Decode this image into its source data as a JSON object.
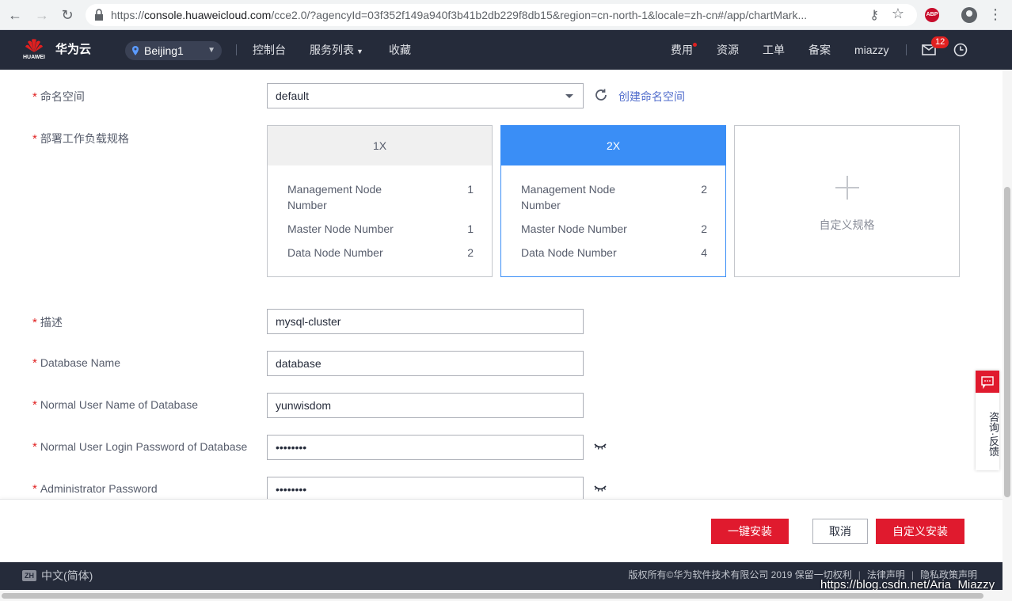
{
  "browser": {
    "url_prefix": "https://",
    "url_host": "console.huaweicloud.com",
    "url_rest": "/cce2.0/?agencyId=03f352f149a940f3b41b2db229f8db15&region=cn-north-1&locale=zh-cn#/app/chartMark...",
    "abp_label": "ABP"
  },
  "topnav": {
    "logo_text": "HUAWEI",
    "brand": "华为云",
    "region": "Beijing1",
    "console": "控制台",
    "services": "服务列表",
    "favorites": "收藏",
    "billing": "费用",
    "resources": "资源",
    "tickets": "工单",
    "filing": "备案",
    "user": "miazzy",
    "mail_count": "12"
  },
  "form": {
    "namespace": {
      "label": "命名空间",
      "value": "default",
      "create_link": "创建命名空间"
    },
    "workload_spec": {
      "label": "部署工作负载规格",
      "cards": [
        {
          "title": "1X",
          "rows": [
            {
              "name": "Management Node Number",
              "value": "1"
            },
            {
              "name": "Master Node Number",
              "value": "1"
            },
            {
              "name": "Data Node Number",
              "value": "2"
            }
          ]
        },
        {
          "title": "2X",
          "rows": [
            {
              "name": "Management Node Number",
              "value": "2"
            },
            {
              "name": "Master Node Number",
              "value": "2"
            },
            {
              "name": "Data Node Number",
              "value": "4"
            }
          ]
        }
      ],
      "custom_label": "自定义规格"
    },
    "description": {
      "label": "描述",
      "value": "mysql-cluster"
    },
    "db_name": {
      "label": "Database Name",
      "value": "database"
    },
    "db_user": {
      "label": "Normal User Name of Database",
      "value": "yunwisdom"
    },
    "db_password": {
      "label": "Normal User Login Password of Database",
      "value": "••••••••"
    },
    "admin_password": {
      "label": "Administrator Password",
      "value": "••••••••"
    }
  },
  "actions": {
    "quick_install": "一键安装",
    "cancel": "取消",
    "custom_install": "自定义安装"
  },
  "footer": {
    "lang_badge": "ZH",
    "language": "中文(简体)",
    "copyright": "版权所有©华为软件技术有限公司 2019 保留一切权利",
    "legal": "法律声明",
    "privacy": "隐私政策声明",
    "watermark": "https://blog.csdn.net/Aria_Miazzy"
  },
  "feedback": {
    "text": "咨询·反馈"
  },
  "colors": {
    "nav_bg": "#252b3a",
    "accent_red": "#e01a2e",
    "selected_blue": "#3a8ef6",
    "link_blue": "#526ecc"
  }
}
